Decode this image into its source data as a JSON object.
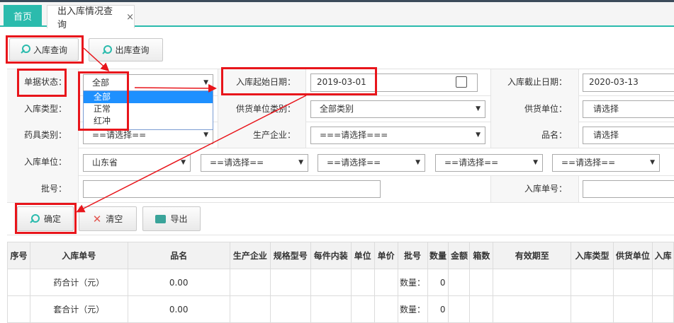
{
  "tabs": {
    "home": "首页",
    "active": "出入库情况查询",
    "close": "×"
  },
  "query_buttons": {
    "in": "入库查询",
    "out": "出库查询"
  },
  "form": {
    "status_label": "单据状态：",
    "status_value": "全部",
    "status_options": [
      "全部",
      "正常",
      "红冲"
    ],
    "in_type_label": "入库类型：",
    "drug_cat_label": "药具类别：",
    "drug_cat_value": "==请选择==",
    "start_date_label": "入库起始日期：",
    "start_date_value": "2019-03-01",
    "supplier_cat_label": "供货单位类别：",
    "supplier_cat_value": "全部类别",
    "manufacturer_label": "生产企业：",
    "manufacturer_value": "===请选择===",
    "end_date_label": "入库截止日期：",
    "end_date_value": "2020-03-13",
    "supplier_label": "供货单位：",
    "supplier_value": "请选择",
    "product_label": "品名：",
    "product_value": "请选择",
    "in_unit_label": "入库单位：",
    "province_value": "山东省",
    "unit_sel_2": "==请选择==",
    "unit_sel_3": "==请选择==",
    "unit_sel_4": "==请选择==",
    "unit_sel_5": "==请选择==",
    "batch_label": "批号：",
    "in_no_label": "入库单号："
  },
  "actions": {
    "confirm": "确定",
    "clear": "清空",
    "export": "导出"
  },
  "table": {
    "headers": [
      "序号",
      "入库单号",
      "品名",
      "生产企业",
      "规格型号",
      "每件内装",
      "单位",
      "单价",
      "批号",
      "数量",
      "金额",
      "箱数",
      "有效期至",
      "入库类型",
      "供货单位",
      "入库"
    ],
    "rows": [
      {
        "no": "",
        "label": "药合计（元）",
        "value": "0.00",
        "qty_label": "数量：",
        "qty": "0"
      },
      {
        "no": "",
        "label": "套合计（元）",
        "value": "0.00",
        "qty_label": "数量：",
        "qty": "0"
      }
    ]
  }
}
